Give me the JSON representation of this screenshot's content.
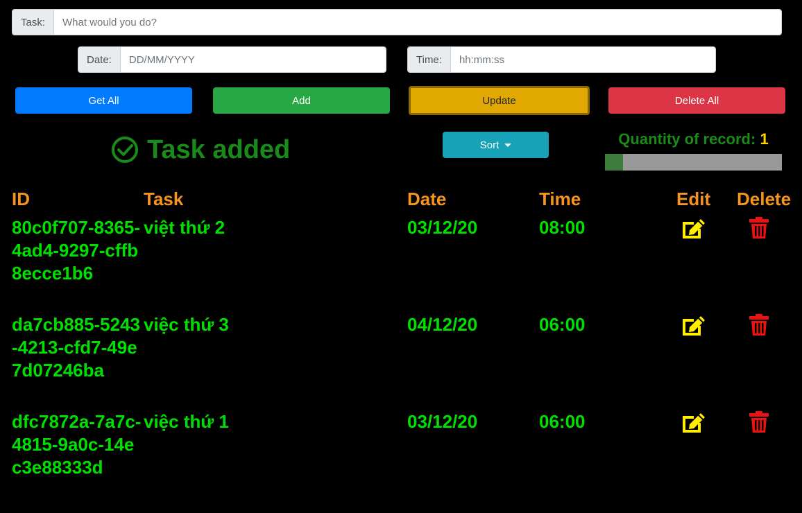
{
  "form": {
    "task": {
      "label": "Task:",
      "placeholder": "What would you do?"
    },
    "date": {
      "label": "Date:",
      "placeholder": "DD/MM/YYYY"
    },
    "time": {
      "label": "Time:",
      "placeholder": "hh:mm:ss"
    }
  },
  "buttons": {
    "get_all": "Get All",
    "add": "Add",
    "update": "Update",
    "delete_all": "Delete All",
    "sort": "Sort"
  },
  "status": {
    "message": "Task added",
    "icon": "check-circle-icon",
    "color": "#1a8a1a"
  },
  "quantity": {
    "label": "Quantity of record:",
    "value": "1",
    "progress_fraction": 0.1
  },
  "table": {
    "headers": {
      "id": "ID",
      "task": "Task",
      "date": "Date",
      "time": "Time",
      "edit": "Edit",
      "delete": "Delete"
    },
    "rows": [
      {
        "id": "80c0f707-8365-4ad4-9297-cffb8ecce1b6",
        "task": "việt thứ 2",
        "date": "03/12/20",
        "time": "08:00"
      },
      {
        "id": "da7cb885-5243-4213-cfd7-49e7d07246ba",
        "task": "việc thứ 3",
        "date": "04/12/20",
        "time": "06:00"
      },
      {
        "id": "dfc7872a-7a7c-4815-9a0c-14ec3e88333d",
        "task": "việc thứ 1",
        "date": "03/12/20",
        "time": "06:00"
      }
    ]
  },
  "colors": {
    "header": "#f7941d",
    "cell": "#00e000",
    "edit_icon": "#ffee00",
    "delete_icon": "#ee1111"
  }
}
